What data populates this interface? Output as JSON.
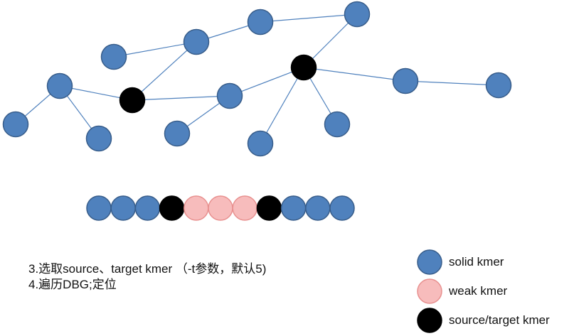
{
  "colors": {
    "solid": "#4f81bd",
    "solid_stroke": "#385d8a",
    "weak": "#f7bcbc",
    "weak_stroke": "#e8908f",
    "source_target": "#000000",
    "edge": "#4f81bd"
  },
  "graph": {
    "nodes": [
      {
        "id": "n1",
        "kind": "solid"
      },
      {
        "id": "n2",
        "kind": "solid"
      },
      {
        "id": "n3",
        "kind": "solid"
      },
      {
        "id": "n4",
        "kind": "solid"
      },
      {
        "id": "n5",
        "kind": "solid"
      },
      {
        "id": "n6",
        "kind": "source_target"
      },
      {
        "id": "n7",
        "kind": "solid"
      },
      {
        "id": "n8",
        "kind": "solid"
      },
      {
        "id": "n9",
        "kind": "source_target"
      },
      {
        "id": "n10",
        "kind": "solid"
      },
      {
        "id": "n11",
        "kind": "solid"
      },
      {
        "id": "n12",
        "kind": "solid"
      },
      {
        "id": "n13",
        "kind": "solid"
      },
      {
        "id": "n14",
        "kind": "solid"
      },
      {
        "id": "n15",
        "kind": "solid"
      },
      {
        "id": "n16",
        "kind": "solid"
      }
    ],
    "edges": [
      [
        "n1",
        "n2"
      ],
      [
        "n2",
        "n3"
      ],
      [
        "n3",
        "n4"
      ],
      [
        "n2",
        "n6"
      ],
      [
        "n5",
        "n6"
      ],
      [
        "n5",
        "n7"
      ],
      [
        "n5",
        "n8"
      ],
      [
        "n6",
        "n10"
      ],
      [
        "n10",
        "n11"
      ],
      [
        "n10",
        "n9"
      ],
      [
        "n4",
        "n9"
      ],
      [
        "n9",
        "n12"
      ],
      [
        "n9",
        "n13"
      ],
      [
        "n9",
        "n14"
      ],
      [
        "n12",
        "n15"
      ]
    ]
  },
  "kmer_chain": [
    "solid",
    "solid",
    "solid",
    "source_target",
    "weak",
    "weak",
    "weak",
    "source_target",
    "solid",
    "solid",
    "solid"
  ],
  "notes": {
    "line1": "3.选取source、target kmer （-t参数，默认5)",
    "line2": "4.遍历DBG;定位"
  },
  "legend": {
    "solid": "solid kmer",
    "weak": "weak kmer",
    "source_target": "source/target kmer"
  }
}
